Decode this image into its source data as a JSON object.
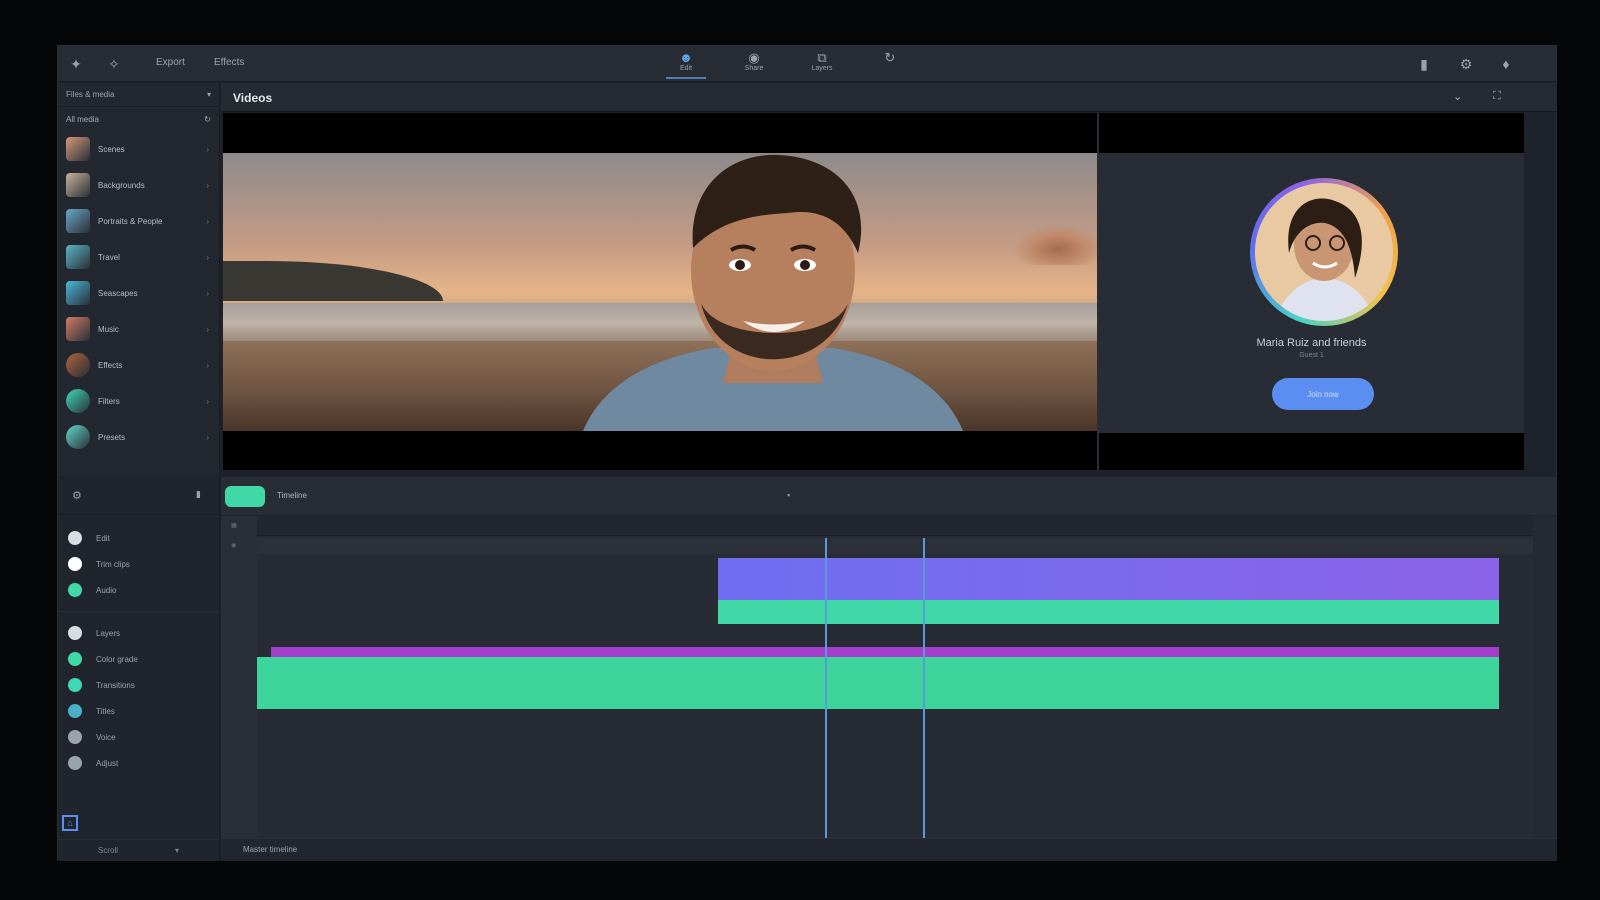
{
  "topbar": {
    "menu": [
      "Export",
      "Effects"
    ],
    "center_tabs": [
      {
        "label": "Edit",
        "icon": "person-icon",
        "active": true
      },
      {
        "label": "Share",
        "icon": "share-icon",
        "active": false
      },
      {
        "label": "Layers",
        "icon": "layers-icon",
        "active": false
      },
      {
        "label": "",
        "icon": "history-icon",
        "active": false
      }
    ]
  },
  "media_panel": {
    "header": "Files & media",
    "subheader": "All media",
    "items": [
      {
        "label": "Scenes",
        "color": "#d49a7c"
      },
      {
        "label": "Backgrounds",
        "color": "#c9b39b"
      },
      {
        "label": "Portraits & People",
        "color": "#6aa6c9"
      },
      {
        "label": "Travel",
        "color": "#5bb6c6"
      },
      {
        "label": "Seascapes",
        "color": "#4ab8d8"
      },
      {
        "label": "Music",
        "color": "#d07d63"
      },
      {
        "label": "Effects",
        "color": "#b0643f"
      },
      {
        "label": "Filters",
        "color": "#3fd8b6"
      },
      {
        "label": "Presets",
        "color": "#5fd8c9"
      }
    ]
  },
  "viewer": {
    "title": "Videos"
  },
  "profile_card": {
    "name": "Maria Ruiz and friends",
    "subtitle": "Guest 1",
    "button_label": "Join now"
  },
  "timeline": {
    "toolbar_label": "Timeline",
    "tool_groups": {
      "top": [
        {
          "label": "Edit",
          "color": "#d9dde3"
        },
        {
          "label": "Trim clips",
          "color": "#ffffff"
        },
        {
          "label": "Audio",
          "color": "#3fd8a6"
        }
      ],
      "bottom": [
        {
          "label": "Layers",
          "color": "#d9dde3"
        },
        {
          "label": "Color grade",
          "color": "#3fd8a6"
        },
        {
          "label": "Transitions",
          "color": "#3fd8b6"
        },
        {
          "label": "Titles",
          "color": "#4ab0c8"
        },
        {
          "label": "Voice",
          "color": "#9aa2ac"
        },
        {
          "label": "Adjust",
          "color": "#9aa2ac"
        }
      ]
    },
    "bottom_label": "Scroll",
    "footer_label": "Master timeline"
  },
  "colors": {
    "accent_green": "#3fd8a6",
    "accent_purple": "#7f6cf0",
    "accent_blue": "#5b8ef0",
    "magenta": "#a23ec9"
  }
}
